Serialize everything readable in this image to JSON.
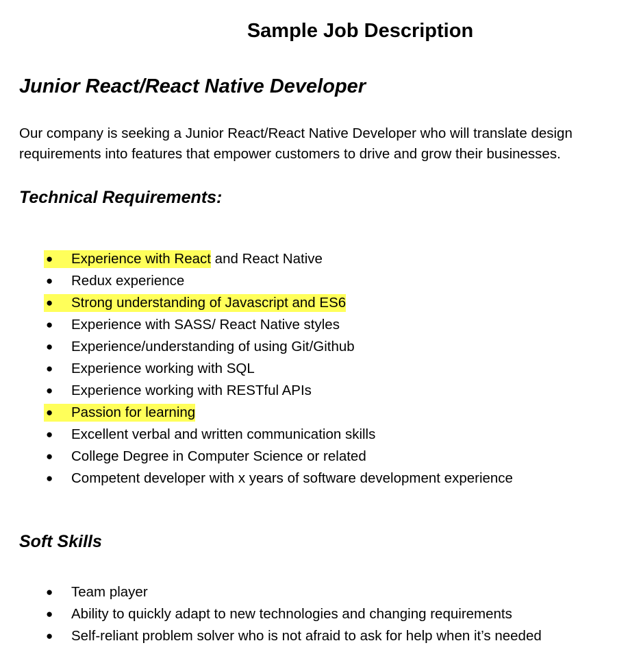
{
  "document": {
    "title": "Sample Job Description",
    "job_title": "Junior React/React Native Developer",
    "intro": [
      "Our company is seeking a Junior React/React Native Developer who will translate design",
      "requirements into features that empower customers to drive and grow their businesses."
    ],
    "highlight_color": "#ffff5a"
  },
  "technical": {
    "heading": "Technical Requirements:",
    "bullet_glyph": "●",
    "items": [
      {
        "highlighted": "Experience with React",
        "rest": " and React Native"
      },
      {
        "highlighted": "",
        "rest": "Redux experience"
      },
      {
        "highlighted": "Strong understanding of Javascript and ES6",
        "rest": ""
      },
      {
        "highlighted": "",
        "rest": "Experience with SASS/ React Native styles"
      },
      {
        "highlighted": "",
        "rest": "Experience/understanding of using Git/Github"
      },
      {
        "highlighted": "",
        "rest": "Experience working with SQL"
      },
      {
        "highlighted": "",
        "rest": "Experience working with RESTful APIs"
      },
      {
        "highlighted": "Passion for learning",
        "rest": ""
      },
      {
        "highlighted": "",
        "rest": "Excellent verbal and written communication skills"
      },
      {
        "highlighted": "",
        "rest": "College Degree in Computer Science or related"
      },
      {
        "highlighted": "",
        "rest": "Competent developer with x years of software development experience"
      }
    ]
  },
  "soft": {
    "heading": "Soft Skills",
    "bullet_glyph": "●",
    "items": [
      "Team player",
      "Ability to quickly adapt to new technologies and changing requirements",
      "Self-reliant problem solver who is not afraid to ask for help when it’s needed"
    ]
  }
}
